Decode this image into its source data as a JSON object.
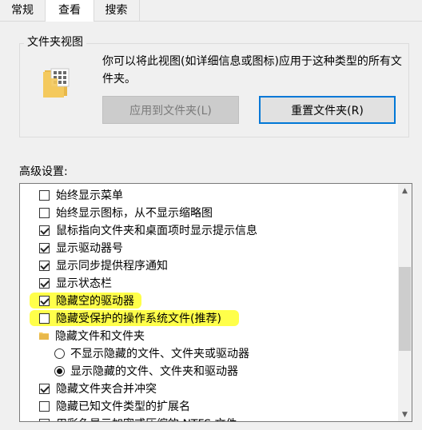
{
  "tabs": [
    {
      "label": "常规",
      "active": false
    },
    {
      "label": "查看",
      "active": true
    },
    {
      "label": "搜索",
      "active": false
    }
  ],
  "folder_views": {
    "title": "文件夹视图",
    "description": "你可以将此视图(如详细信息或图标)应用于这种类型的所有文件夹。",
    "apply_button": "应用到文件夹(L)",
    "reset_button": "重置文件夹(R)"
  },
  "advanced": {
    "label": "高级设置:",
    "items": [
      {
        "type": "checkbox",
        "checked": false,
        "label": "始终显示菜单"
      },
      {
        "type": "checkbox",
        "checked": false,
        "label": "始终显示图标，从不显示缩略图"
      },
      {
        "type": "checkbox",
        "checked": true,
        "label": "鼠标指向文件夹和桌面项时显示提示信息"
      },
      {
        "type": "checkbox",
        "checked": true,
        "label": "显示驱动器号"
      },
      {
        "type": "checkbox",
        "checked": true,
        "label": "显示同步提供程序通知"
      },
      {
        "type": "checkbox",
        "checked": true,
        "label": "显示状态栏"
      },
      {
        "type": "checkbox",
        "checked": true,
        "label": "隐藏空的驱动器",
        "highlighted": true
      },
      {
        "type": "checkbox",
        "checked": false,
        "label": "隐藏受保护的操作系统文件(推荐)",
        "highlighted": true
      },
      {
        "type": "folder",
        "label": "隐藏文件和文件夹"
      },
      {
        "type": "radio",
        "selected": false,
        "label": "不显示隐藏的文件、文件夹或驱动器"
      },
      {
        "type": "radio",
        "selected": true,
        "label": "显示隐藏的文件、文件夹和驱动器"
      },
      {
        "type": "checkbox",
        "checked": true,
        "label": "隐藏文件夹合并冲突"
      },
      {
        "type": "checkbox",
        "checked": false,
        "label": "隐藏已知文件类型的扩展名"
      },
      {
        "type": "checkbox",
        "checked": false,
        "label": "用彩色显示加密或压缩的 NTFS 文件"
      }
    ]
  },
  "scrollbar": {
    "position_fraction": 0.55,
    "visible_fraction": 0.4
  },
  "colors": {
    "accent": "#0078d7",
    "highlight": "#ffff4a",
    "folder": "#f4c95d"
  },
  "icons": {
    "folder": "folder-icon",
    "checkbox": "checkbox-icon",
    "radio": "radio-icon"
  }
}
